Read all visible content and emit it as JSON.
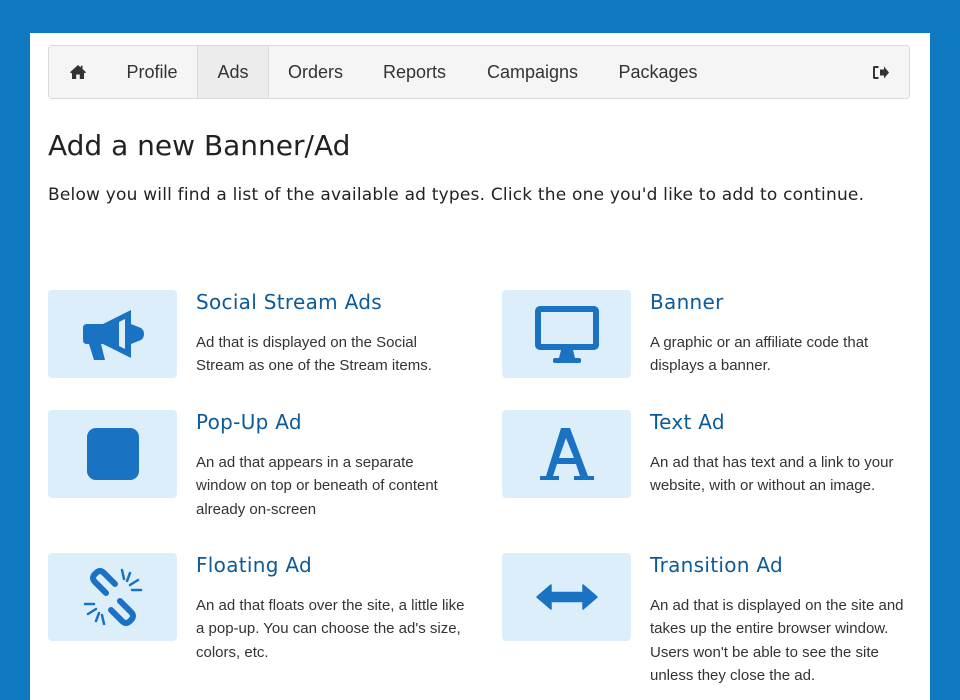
{
  "nav": {
    "items": [
      {
        "label": "Profile"
      },
      {
        "label": "Ads"
      },
      {
        "label": "Orders"
      },
      {
        "label": "Reports"
      },
      {
        "label": "Campaigns"
      },
      {
        "label": "Packages"
      }
    ],
    "active": "Ads",
    "home_icon": "home-icon",
    "logout_icon": "sign-out-icon"
  },
  "page": {
    "title": "Add a new Banner/Ad",
    "intro": "Below you will find a list of the available ad types. Click the one you'd like to add to continue."
  },
  "ad_types": [
    {
      "title": "Social Stream Ads",
      "description": "Ad that is displayed on the Social Stream as one of the Stream items.",
      "icon": "megaphone-icon"
    },
    {
      "title": "Banner",
      "description": "A graphic or an affiliate code that displays a banner.",
      "icon": "monitor-icon"
    },
    {
      "title": "Pop-Up Ad",
      "description": "An ad that appears in a separate window on top or beneath of content already on-screen",
      "icon": "square-icon"
    },
    {
      "title": "Text Ad",
      "description": "An ad that has text and a link to your website, with or without an image.",
      "icon": "font-icon"
    },
    {
      "title": "Floating Ad",
      "description": "An ad that floats over the site, a little like a pop-up. You can choose the ad's size, colors, etc.",
      "icon": "unlink-icon"
    },
    {
      "title": "Transition Ad",
      "description": "An ad that is displayed on the site and takes up the entire browser window. Users won't be able to see the site unless they close the ad.",
      "icon": "arrows-horizontal-icon"
    }
  ],
  "colors": {
    "background": "#0f79c2",
    "accent": "#1a73c2",
    "title": "#0d5a99",
    "icon_box": "#ddeefb"
  }
}
